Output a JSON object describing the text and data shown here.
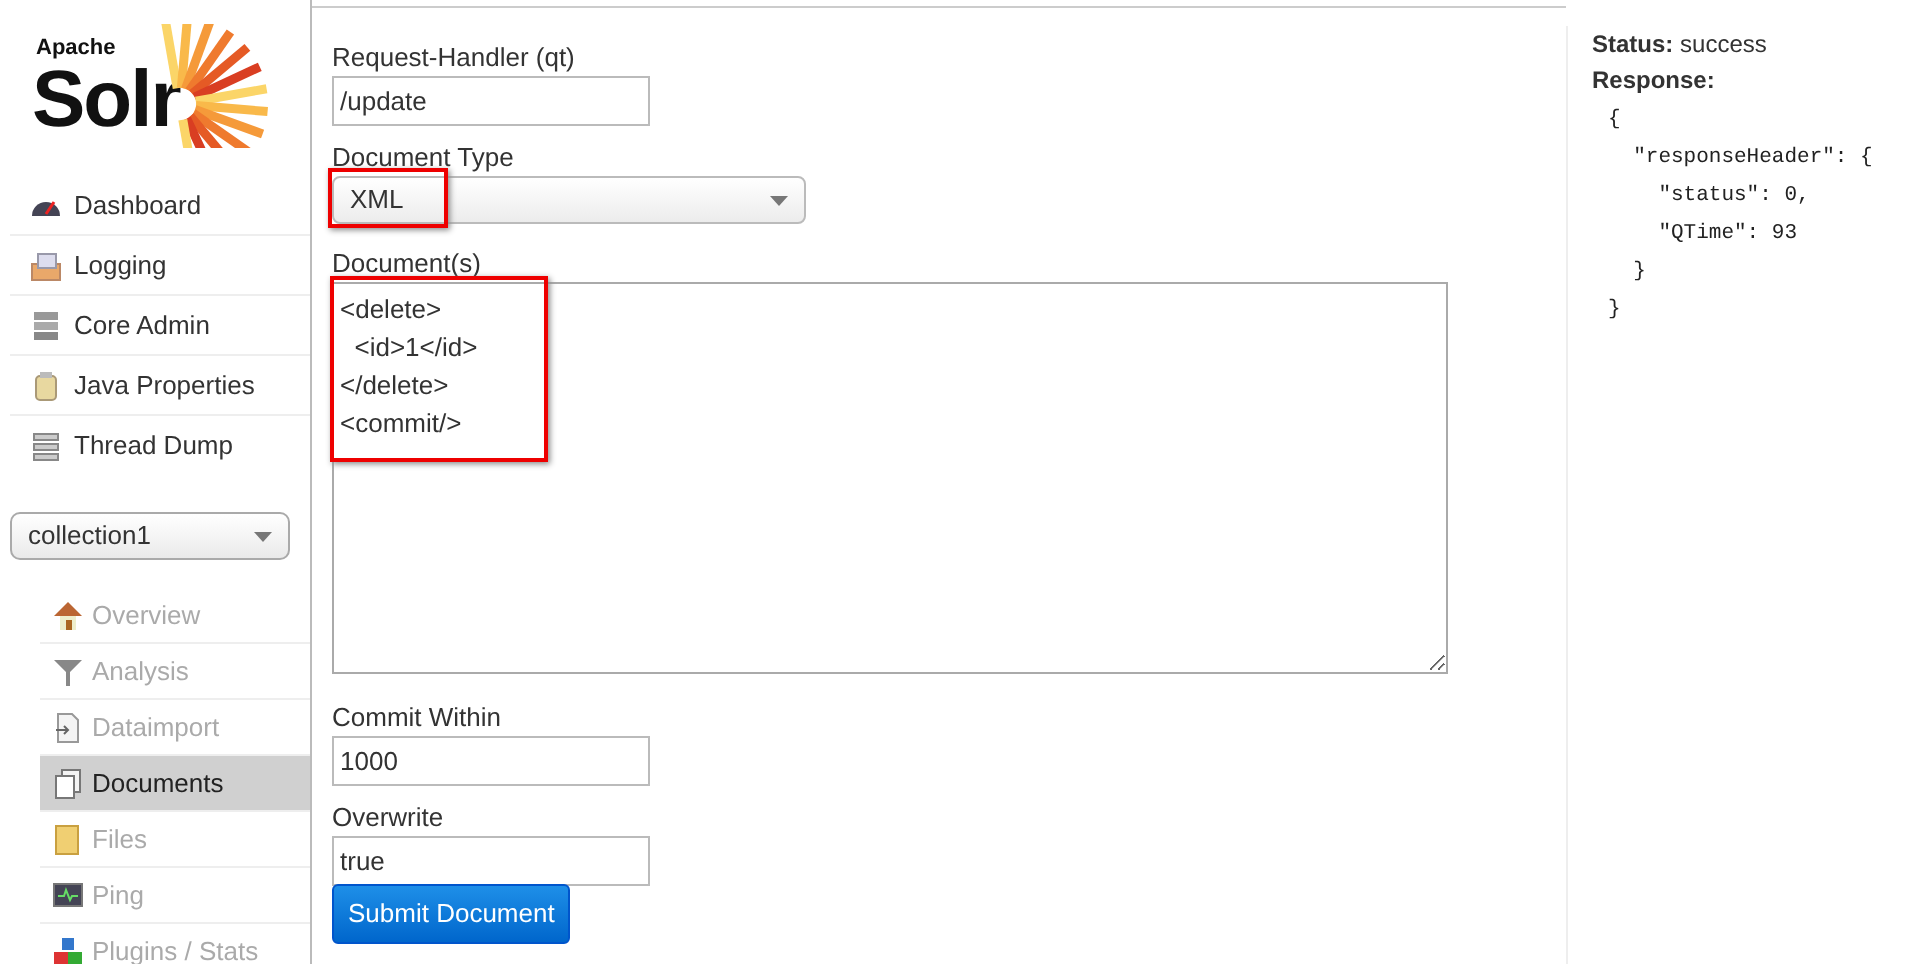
{
  "logo": {
    "small": "Apache",
    "big": "Solr"
  },
  "nav": [
    {
      "label": "Dashboard"
    },
    {
      "label": "Logging"
    },
    {
      "label": "Core Admin"
    },
    {
      "label": "Java Properties"
    },
    {
      "label": "Thread Dump"
    }
  ],
  "core_selector": {
    "value": "collection1"
  },
  "core_nav": [
    {
      "label": "Overview",
      "selected": false
    },
    {
      "label": "Analysis",
      "selected": false
    },
    {
      "label": "Dataimport",
      "selected": false
    },
    {
      "label": "Documents",
      "selected": true
    },
    {
      "label": "Files",
      "selected": false
    },
    {
      "label": "Ping",
      "selected": false
    },
    {
      "label": "Plugins / Stats",
      "selected": false
    }
  ],
  "form": {
    "request_handler": {
      "label": "Request-Handler (qt)",
      "value": "/update"
    },
    "document_type": {
      "label": "Document Type",
      "value": "XML",
      "highlighted": true
    },
    "documents": {
      "label": "Document(s)",
      "lines": [
        "<delete>",
        "  <id>1</id>",
        "</delete>",
        "<commit/>"
      ],
      "highlighted": true
    },
    "commit_within": {
      "label": "Commit Within",
      "value": "1000"
    },
    "overwrite": {
      "label": "Overwrite",
      "value": "true"
    },
    "submit": "Submit Document"
  },
  "result": {
    "status_label": "Status:",
    "status": "success",
    "response_label": "Response:",
    "lines": [
      "{",
      "  \"responseHeader\": {",
      "    \"status\": 0,",
      "    \"QTime\": 93",
      "  }",
      "}"
    ]
  }
}
